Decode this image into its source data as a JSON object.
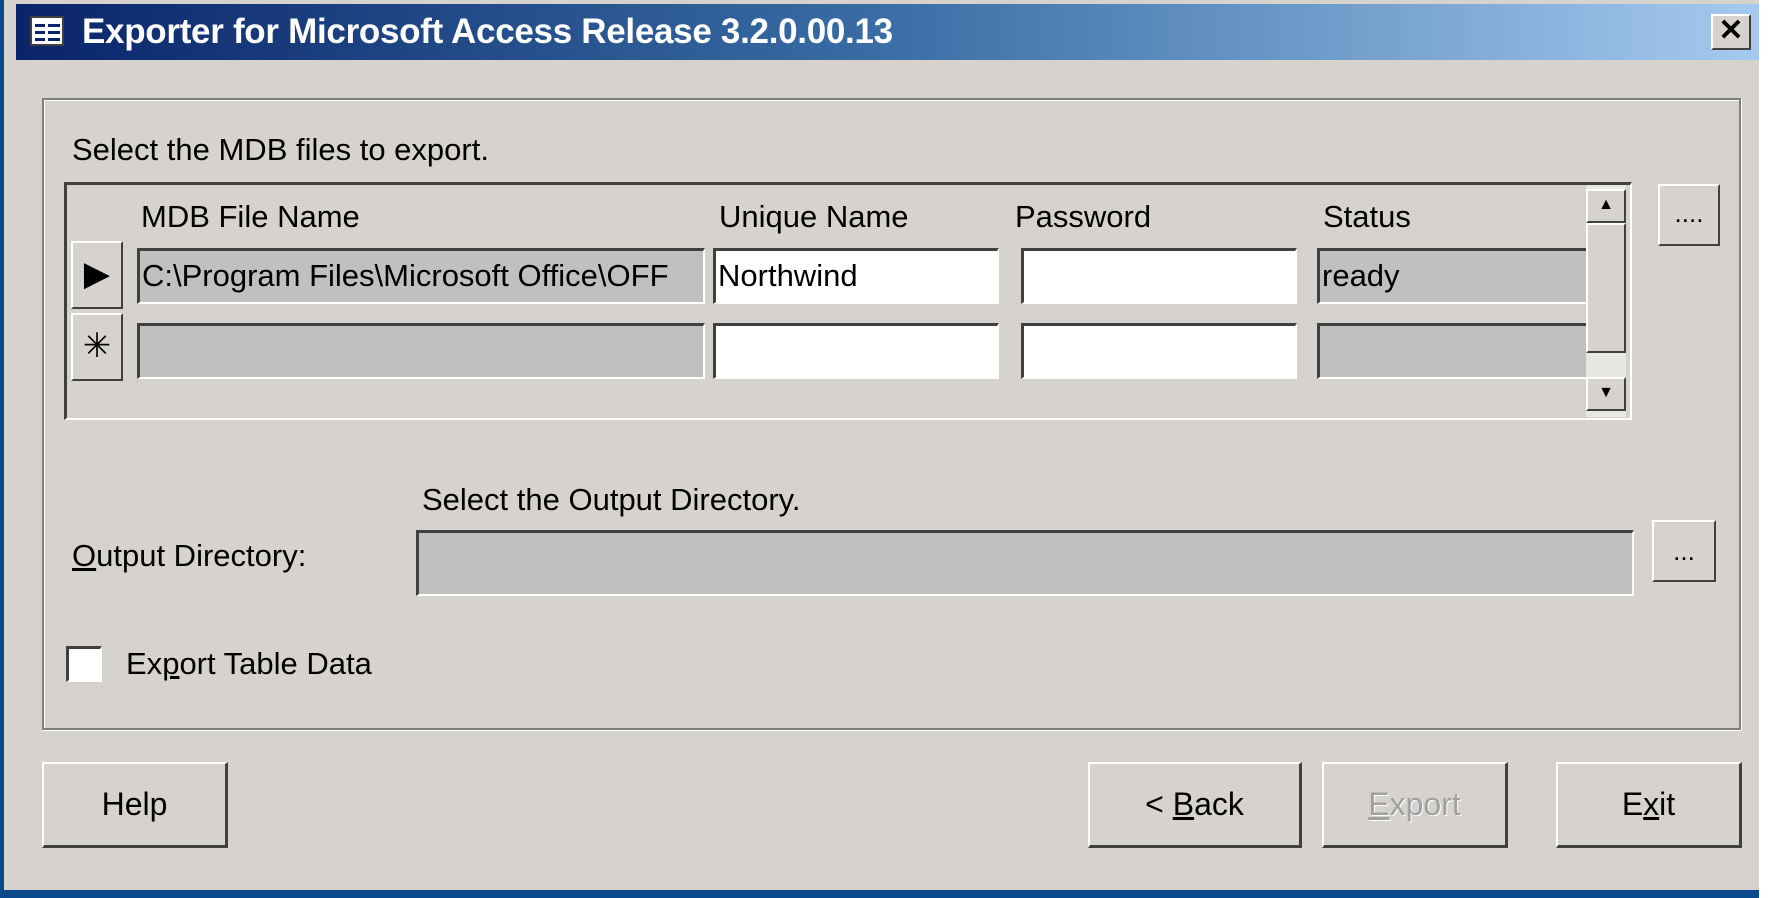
{
  "window": {
    "title": "Exporter for Microsoft Access Release 3.2.0.00.13",
    "close_glyph": "✕"
  },
  "mdb_section": {
    "instruction": "Select the MDB files to export.",
    "columns": [
      "MDB File Name",
      "Unique Name",
      "Password",
      "Status"
    ],
    "rows": [
      {
        "selector_glyph": "▶",
        "file_name": "C:\\Program Files\\Microsoft Office\\OFF",
        "unique_name": "Northwind",
        "password": "",
        "status": "ready"
      },
      {
        "selector_glyph": "✳",
        "file_name": "",
        "unique_name": "",
        "password": "",
        "status": ""
      }
    ],
    "browse_label": "....",
    "scroll_up_glyph": "▲",
    "scroll_down_glyph": "▼"
  },
  "output_section": {
    "instruction": "Select the Output Directory.",
    "label_underlined": "O",
    "label_rest": "utput Directory:",
    "value": "",
    "browse_label": "..."
  },
  "options": {
    "export_table_data_label_pre": "Ex",
    "export_table_data_label_underlined": "p",
    "export_table_data_label_post": "ort Table Data",
    "export_table_data_checked": false
  },
  "buttons": {
    "help": "Help",
    "back_pre": "< ",
    "back_underlined": "B",
    "back_post": "ack",
    "export_underlined": "E",
    "export_post": "xport",
    "export_enabled": false,
    "exit_pre": "E",
    "exit_underlined": "x",
    "exit_post": "it"
  }
}
